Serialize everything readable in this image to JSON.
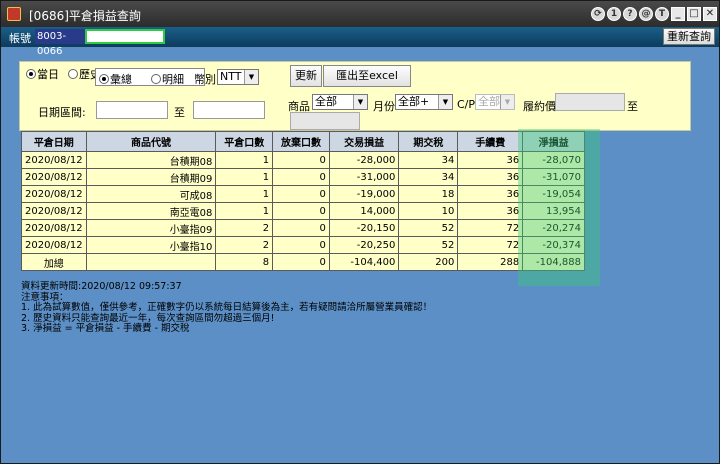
{
  "window": {
    "title": "[0686]平倉損益查詢",
    "buttons": [
      "⟳",
      "1",
      "?",
      "@",
      "T",
      "_",
      "□",
      "✕"
    ]
  },
  "account": {
    "label": "帳號",
    "value": "8003-0066",
    "requery": "重新查詢"
  },
  "controls": {
    "period_today": "當日",
    "period_history": "歷史",
    "view_summary": "彙總",
    "view_detail": "明細",
    "currency_label": "幣別",
    "currency_value": "NTT",
    "refresh": "更新",
    "export": "匯出至excel",
    "date_range_label": "日期區間:",
    "to": "至",
    "product_label": "商品",
    "product_value": "全部",
    "month_label": "月份",
    "month_value": "全部+",
    "cp_label": "C/P",
    "cp_value": "全部",
    "strike_label": "履約價",
    "strike_to": "至"
  },
  "table": {
    "headers": [
      "平倉日期",
      "商品代號",
      "平倉口數",
      "放棄口數",
      "交易損益",
      "期交稅",
      "手續費",
      "淨損益"
    ],
    "rows": [
      [
        "2020/08/12",
        "台積期08",
        "1",
        "0",
        "-28,000",
        "34",
        "36",
        "-28,070"
      ],
      [
        "2020/08/12",
        "台積期09",
        "1",
        "0",
        "-31,000",
        "34",
        "36",
        "-31,070"
      ],
      [
        "2020/08/12",
        "可成08",
        "1",
        "0",
        "-19,000",
        "18",
        "36",
        "-19,054"
      ],
      [
        "2020/08/12",
        "南亞電08",
        "1",
        "0",
        "14,000",
        "10",
        "36",
        "13,954"
      ],
      [
        "2020/08/12",
        "小臺指09",
        "2",
        "0",
        "-20,150",
        "52",
        "72",
        "-20,274"
      ],
      [
        "2020/08/12",
        "小臺指10",
        "2",
        "0",
        "-20,250",
        "52",
        "72",
        "-20,374"
      ]
    ],
    "total": [
      "加總",
      "",
      "8",
      "0",
      "-104,400",
      "200",
      "288",
      "-104,888"
    ]
  },
  "notes": {
    "updated": "資料更新時間:2020/08/12 09:57:37",
    "title": " 注意事項：",
    "n1": "1. 此為試算數值，僅供參考，正確數字仍以系統每日結算後為主，若有疑問請洽所屬營業員確認！",
    "n2": "2. 歷史資料只能查詢最近一年，每次查詢區間勿超過三個月!",
    "n3": "3. 淨損益 = 平倉損益 - 手續費 - 期交稅"
  }
}
